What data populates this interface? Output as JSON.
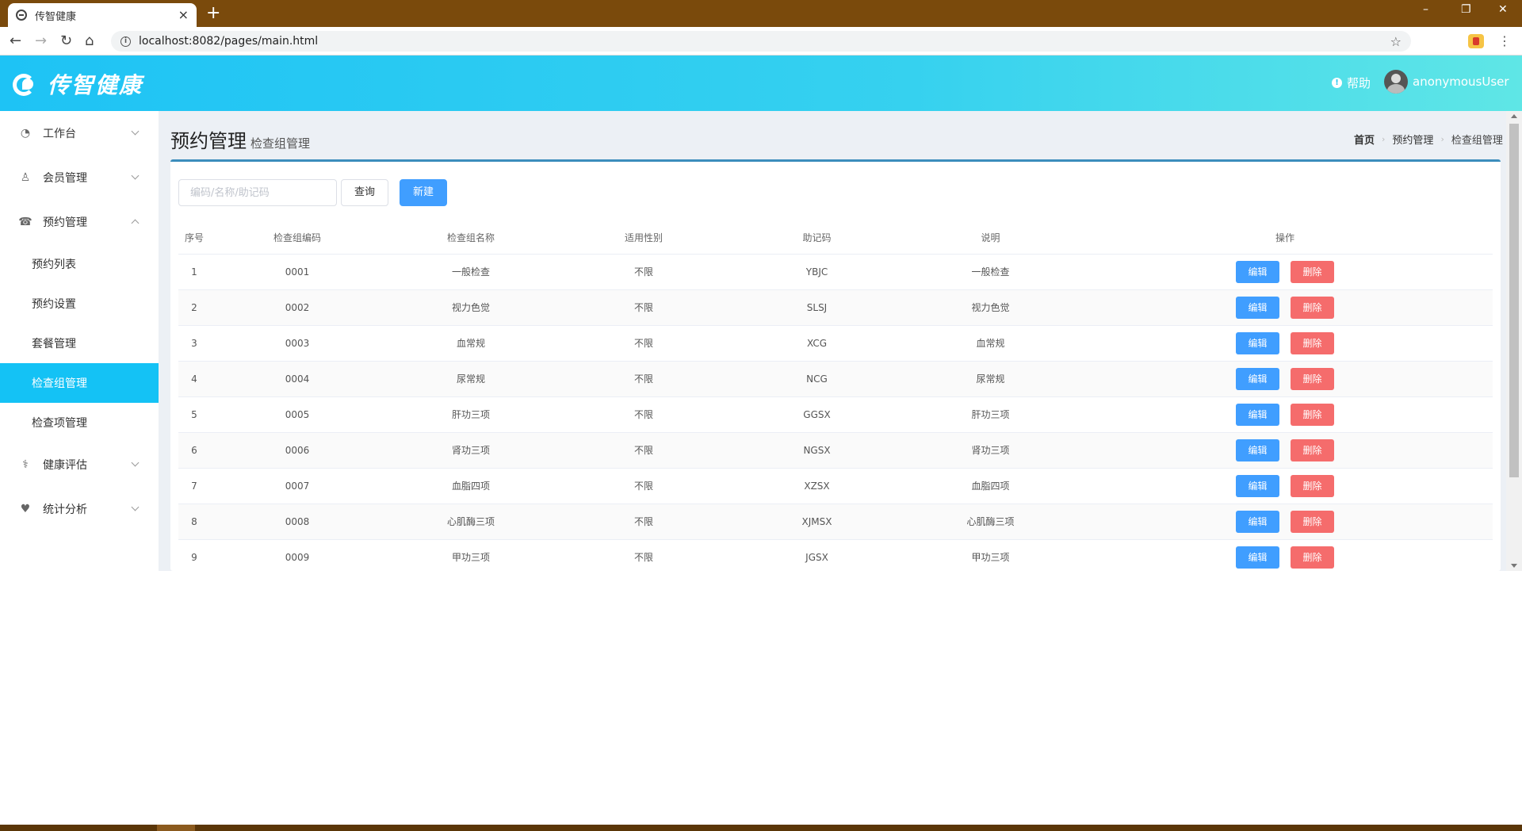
{
  "browser": {
    "tab_title": "传智健康",
    "tab_close": "×",
    "new_tab": "+",
    "url": "localhost:8082/pages/main.html",
    "win_min": "–",
    "win_max": "❐",
    "win_close": "✕",
    "back": "←",
    "forward": "→",
    "reload": "↻",
    "home": "⌂",
    "star": "☆",
    "menu": "⋮"
  },
  "header": {
    "logo_text": "传智健康",
    "help_label": "帮助",
    "username": "anonymousUser"
  },
  "sidebar": {
    "items": [
      {
        "label": "工作台",
        "icon": "dashboard-icon",
        "expanded": false
      },
      {
        "label": "会员管理",
        "icon": "member-icon",
        "expanded": false
      },
      {
        "label": "预约管理",
        "icon": "reservation-icon",
        "expanded": true,
        "children": [
          {
            "label": "预约列表"
          },
          {
            "label": "预约设置"
          },
          {
            "label": "套餐管理"
          },
          {
            "label": "检查组管理",
            "active": true
          },
          {
            "label": "检查项管理"
          }
        ]
      },
      {
        "label": "健康评估",
        "icon": "stethoscope-icon",
        "expanded": false
      },
      {
        "label": "统计分析",
        "icon": "heart-chart-icon",
        "expanded": false
      }
    ]
  },
  "page": {
    "title": "预约管理",
    "subtitle": "检查组管理",
    "breadcrumb": [
      "首页",
      "预约管理",
      "检查组管理"
    ]
  },
  "toolbar": {
    "search_placeholder": "编码/名称/助记码",
    "search_value": "",
    "query_label": "查询",
    "new_label": "新建"
  },
  "table": {
    "headers": [
      "序号",
      "检查组编码",
      "检查组名称",
      "适用性别",
      "助记码",
      "说明",
      "操作"
    ],
    "edit_label": "编辑",
    "delete_label": "删除",
    "rows": [
      {
        "no": "1",
        "code": "0001",
        "name": "一般检查",
        "sex": "不限",
        "helpcode": "YBJC",
        "remark": "一般检查"
      },
      {
        "no": "2",
        "code": "0002",
        "name": "视力色觉",
        "sex": "不限",
        "helpcode": "SLSJ",
        "remark": "视力色觉"
      },
      {
        "no": "3",
        "code": "0003",
        "name": "血常规",
        "sex": "不限",
        "helpcode": "XCG",
        "remark": "血常规"
      },
      {
        "no": "4",
        "code": "0004",
        "name": "尿常规",
        "sex": "不限",
        "helpcode": "NCG",
        "remark": "尿常规"
      },
      {
        "no": "5",
        "code": "0005",
        "name": "肝功三项",
        "sex": "不限",
        "helpcode": "GGSX",
        "remark": "肝功三项"
      },
      {
        "no": "6",
        "code": "0006",
        "name": "肾功三项",
        "sex": "不限",
        "helpcode": "NGSX",
        "remark": "肾功三项"
      },
      {
        "no": "7",
        "code": "0007",
        "name": "血脂四项",
        "sex": "不限",
        "helpcode": "XZSX",
        "remark": "血脂四项"
      },
      {
        "no": "8",
        "code": "0008",
        "name": "心肌酶三项",
        "sex": "不限",
        "helpcode": "XJMSX",
        "remark": "心肌酶三项"
      },
      {
        "no": "9",
        "code": "0009",
        "name": "甲功三项",
        "sex": "不限",
        "helpcode": "JGSX",
        "remark": "甲功三项"
      }
    ]
  },
  "colors": {
    "header_gradient_start": "#1ec3f5",
    "header_gradient_end": "#5fe6e6",
    "active_menu": "#14c2f5",
    "primary": "#409eff",
    "danger": "#f56c6c"
  }
}
